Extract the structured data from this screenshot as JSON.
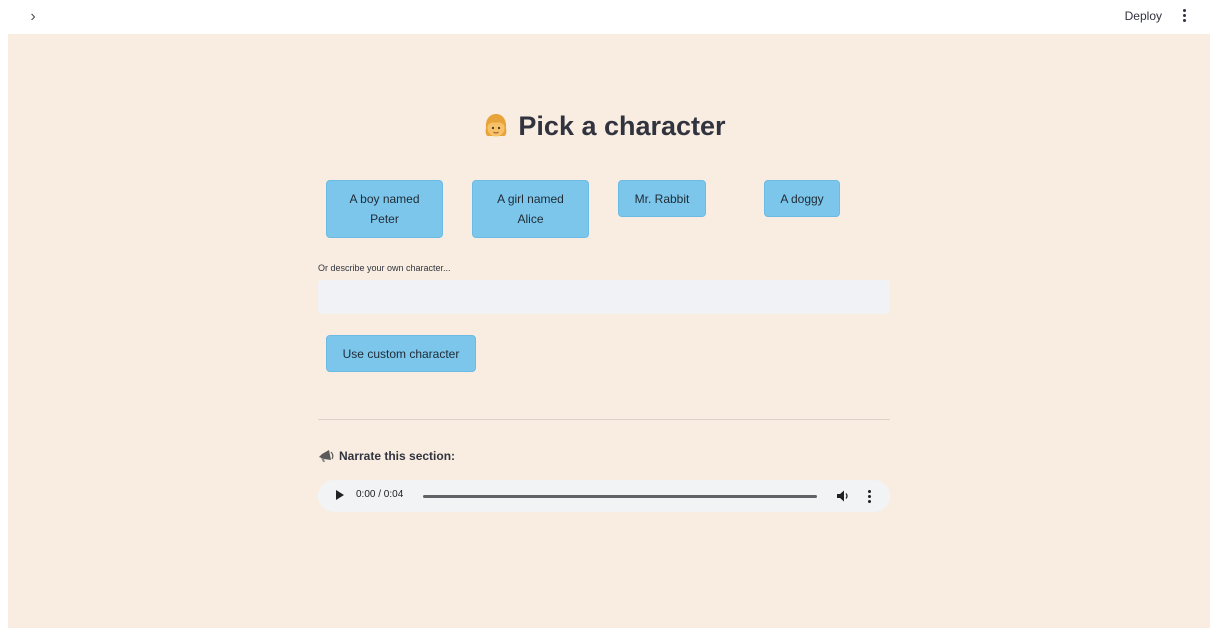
{
  "header": {
    "sidebar_toggle_glyph": "›",
    "deploy_label": "Deploy",
    "menu_icon": "vertical-dots-icon"
  },
  "main": {
    "title": "Pick a character",
    "title_icon": "girl-face-icon",
    "characters": [
      {
        "label": "A boy named Peter"
      },
      {
        "label": "A girl named Alice"
      },
      {
        "label": "Mr. Rabbit"
      },
      {
        "label": "A doggy"
      }
    ],
    "custom": {
      "label": "Or describe your own character...",
      "value": "",
      "button_label": "Use custom character"
    },
    "narrate": {
      "heading": "Narrate this section:",
      "icon": "speaker-icon",
      "audio": {
        "time": "0:00 / 0:04",
        "progress": 0
      }
    }
  },
  "colors": {
    "app_background": "#f8ede0",
    "button_background": "#7cc6ec",
    "input_background": "#f0f2f6",
    "audio_background": "#f1f3f4"
  }
}
